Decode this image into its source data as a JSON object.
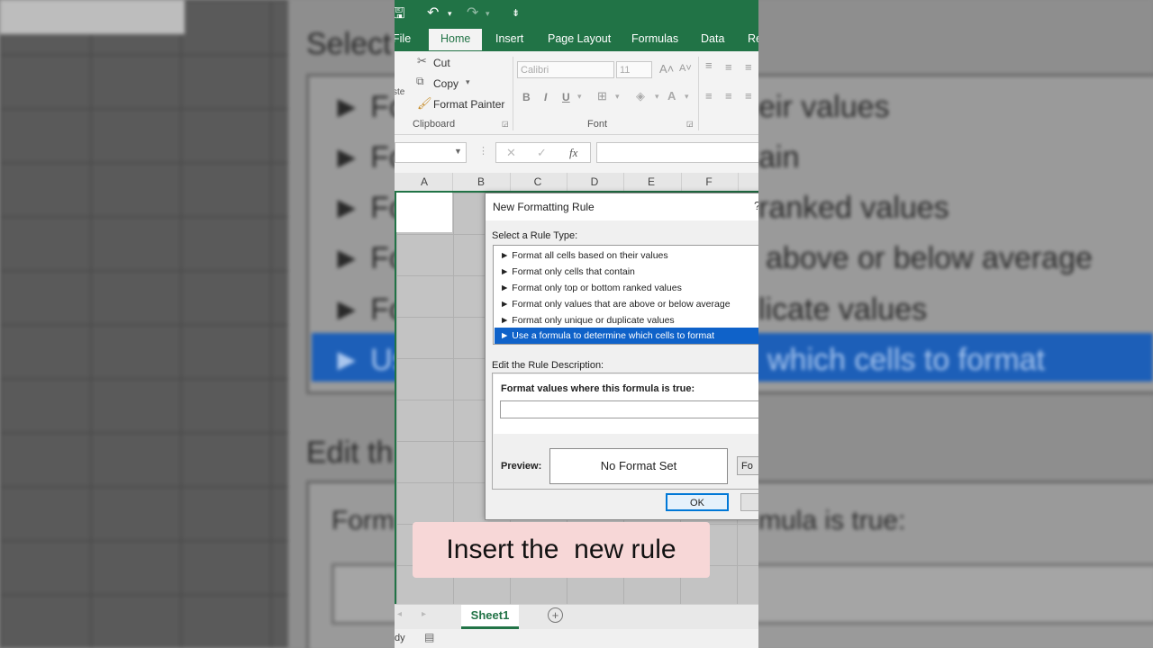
{
  "background": {
    "heading_select": "Select",
    "rules": [
      {
        "prefix": "► Fo",
        "tail": "eir values"
      },
      {
        "prefix": "► Fo",
        "tail": "ain"
      },
      {
        "prefix": "► Fo",
        "tail": "ranked values"
      },
      {
        "prefix": "► Fo",
        "tail": "above or below average"
      },
      {
        "prefix": "► Fo",
        "tail": "licate values"
      },
      {
        "prefix": "► Us",
        "tail": "which cells to format"
      }
    ],
    "heading_edit": "Edit th",
    "formula_label_prefix": "Form",
    "formula_label_tail": "mula is true:"
  },
  "titlebar": {
    "save_glyph": "🖫",
    "undo_glyph": "↶",
    "redo_glyph": "↷",
    "customize_glyph": "⇟"
  },
  "ribbon_tabs": [
    "File",
    "Home",
    "Insert",
    "Page Layout",
    "Formulas",
    "Data",
    "Re"
  ],
  "clipboard": {
    "paste_label": "ste",
    "cut": "Cut",
    "copy": "Copy",
    "format_painter": "Format Painter",
    "group_label": "Clipboard"
  },
  "font": {
    "name": "Calibri",
    "size": "11",
    "group_label": "Font",
    "bold": "B",
    "italic": "I",
    "underline": "U"
  },
  "formula_bar": {
    "fx": "fx",
    "cancel": "✕",
    "enter": "✓"
  },
  "columns": [
    "A",
    "B",
    "C",
    "D",
    "E",
    "F"
  ],
  "dialog": {
    "title": "New Formatting Rule",
    "help": "?",
    "select_label": "Select a Rule Type:",
    "rule_types": [
      "► Format all cells based on their values",
      "► Format only cells that contain",
      "► Format only top or bottom ranked values",
      "► Format only values that are above or below average",
      "► Format only unique or duplicate values",
      "► Use a formula to determine which cells to format"
    ],
    "selected_index": 5,
    "edit_label": "Edit the Rule Description:",
    "formula_label": "Format values where this formula is true:",
    "formula_value": "",
    "preview_label": "Preview:",
    "preview_text": "No Format Set",
    "format_button": "Fo",
    "ok_button": "OK"
  },
  "sheet_tabs": {
    "active": "Sheet1",
    "add": "+"
  },
  "status": {
    "text": "dy"
  },
  "caption": "Insert the  new rule",
  "colors": {
    "excel_green": "#217346",
    "selection_blue": "#0f62c9",
    "caption_bg": "#f7d7d7"
  }
}
